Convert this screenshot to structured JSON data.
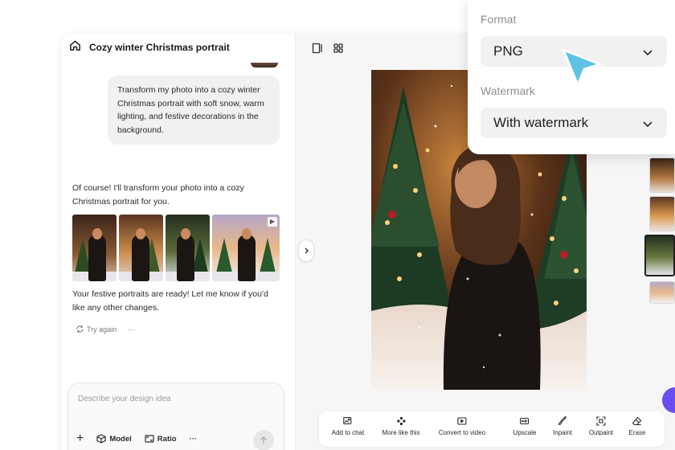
{
  "chat": {
    "title": "Cozy winter Christmas portrait",
    "user_message": "Transform my photo into a cozy winter Christmas portrait with soft snow, warm lighting, and festive decorations in the background.",
    "ai_intro": "Of course! I'll transform your photo into a cozy Christmas portrait for you.",
    "ai_followup": "Your festive portraits are ready! Let me know if you'd like any other changes.",
    "try_again": "Try again",
    "more": "···"
  },
  "composer": {
    "placeholder": "Describe your design idea",
    "add": "+",
    "model_label": "Model",
    "ratio_label": "Ratio",
    "more": "···"
  },
  "toolbar": {
    "items": [
      {
        "label": "Add to chat",
        "icon": "add-image-icon"
      },
      {
        "label": "More like this",
        "icon": "nodes-icon"
      },
      {
        "label": "Convert to video",
        "icon": "play-icon"
      },
      {
        "label": "Upscale",
        "icon": "hd-icon"
      },
      {
        "label": "Inpaint",
        "icon": "brush-icon"
      },
      {
        "label": "Outpaint",
        "icon": "expand-icon"
      },
      {
        "label": "Erase",
        "icon": "eraser-icon"
      }
    ]
  },
  "format_popover": {
    "format_label": "Format",
    "format_value": "PNG",
    "watermark_label": "Watermark",
    "watermark_value": "With watermark"
  },
  "colors": {
    "accent_cursor": "#5ec3e3",
    "fab": "#6a4cf0"
  }
}
